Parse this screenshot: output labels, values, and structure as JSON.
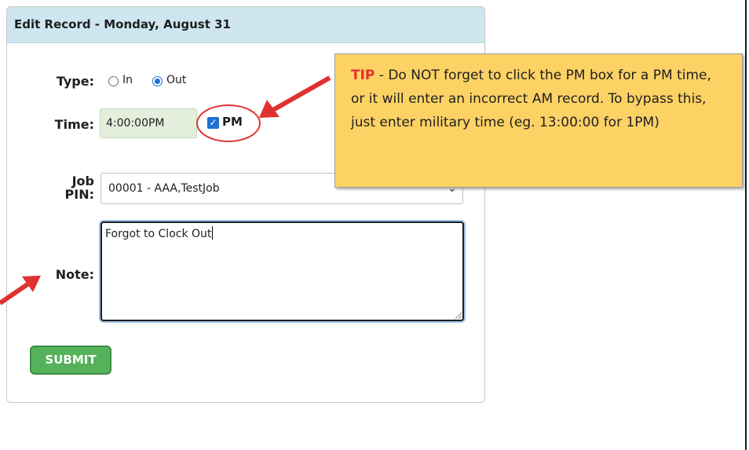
{
  "panel": {
    "title": "Edit Record - Monday, August 31"
  },
  "type_field": {
    "label": "Type:",
    "options": [
      "In",
      "Out"
    ],
    "selected": "Out"
  },
  "time_field": {
    "label": "Time:",
    "value": "4:00:00PM",
    "pm_label": "PM",
    "pm_checked": true
  },
  "job_field": {
    "label_line1": "Job",
    "label_line2": "PIN:",
    "value": "00001 - AAA,TestJob"
  },
  "note_field": {
    "label": "Note:",
    "value": "Forgot to Clock Out"
  },
  "submit_button": {
    "label": "SUBMIT"
  },
  "tip": {
    "keyword": "TIP",
    "text": " - Do NOT forget to click the PM box for a PM time, or it will enter an incorrect AM record. To bypass this, just enter military time (eg. 13:00:00 for 1PM)"
  },
  "colors": {
    "header_bg": "#cde6f0",
    "tip_bg": "#fdd265",
    "tip_keyword": "#e03131",
    "annotation_red": "#e03131",
    "submit_bg": "#55b25a",
    "radio_checkbox_blue": "#1f6fd1",
    "time_input_bg": "#e3efdc"
  },
  "icons": {
    "dropdown": "chevron-down-icon",
    "textarea_resize": "resize-handle-icon"
  }
}
